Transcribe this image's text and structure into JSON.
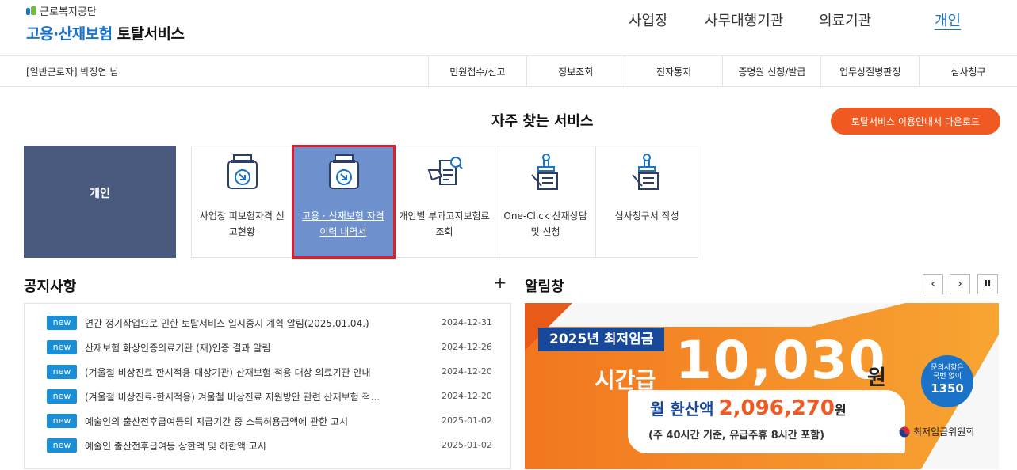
{
  "header": {
    "org_name": "근로복지공단",
    "service_name": "고용·산재보험",
    "service_suffix": "토탈서비스",
    "nav": [
      "사업장",
      "사무대행기관",
      "의료기관",
      "개인"
    ],
    "active_nav": "개인"
  },
  "subbar": {
    "user_label": "[일반근로자] 박정연 님",
    "menu": [
      "민원접수/신고",
      "정보조회",
      "전자통지",
      "증명원 신청/발급",
      "업무상질병판정",
      "심사청구"
    ]
  },
  "services": {
    "title": "자주 찾는 서비스",
    "guide_button": "토탈서비스 이용안내서 다운로드",
    "person_label": "개인",
    "items": [
      {
        "label": "사업장 피보험자격 신고현황",
        "icon": "document-download-icon"
      },
      {
        "label": "고용 · 산재보험 자격 이력 내역서",
        "icon": "document-download-icon"
      },
      {
        "label": "개인별 부과고지보험료 조회",
        "icon": "document-search-icon"
      },
      {
        "label": "One-Click 산재상담 및 신청",
        "icon": "stamp-document-icon"
      },
      {
        "label": "심사청구서 작성",
        "icon": "stamp-document-icon"
      }
    ],
    "highlight_color": "#e11d2b"
  },
  "notices": {
    "title": "공지사항",
    "more": "+",
    "badge": "new",
    "items": [
      {
        "text": "연간 정기작업으로 인한 토탈서비스 일시중지 계획 알림(2025.01.04.)",
        "date": "2024-12-31"
      },
      {
        "text": "산재보험 화상인증의료기관 (재)인증 결과 알림",
        "date": "2024-12-26"
      },
      {
        "text": "(겨울철 비상진료 한시적용-대상기관) 산재보험 적용 대상 의료기관 안내",
        "date": "2024-12-20"
      },
      {
        "text": "(겨울철 비상진료-한시적용) 겨울철 비상진료 지원방안 관련 산재보험 적...",
        "date": "2024-12-20"
      },
      {
        "text": "예술인의 출산전후급여등의 지급기간 중 소득허용금액에 관한 고시",
        "date": "2025-01-02"
      },
      {
        "text": "예술인 출산전후급여등 상한액 및 하한액 고시",
        "date": "2025-01-02"
      }
    ]
  },
  "alert": {
    "title": "알림창",
    "prev": "‹",
    "next": "›",
    "pause": "II",
    "banner": {
      "year_tag": "2025년 최저임금",
      "hourly_label": "시간급",
      "hourly_amount": "10,030",
      "hourly_unit": "원",
      "monthly_label": "월 환산액",
      "monthly_amount": "2,096,270",
      "monthly_unit": "원",
      "monthly_note": "(주 40시간 기준, 유급주휴 8시간 포함)",
      "contact_line1": "문의사항은",
      "contact_line2": "국번 없이",
      "contact_number": "1350",
      "org": "최저임금위원회"
    }
  }
}
